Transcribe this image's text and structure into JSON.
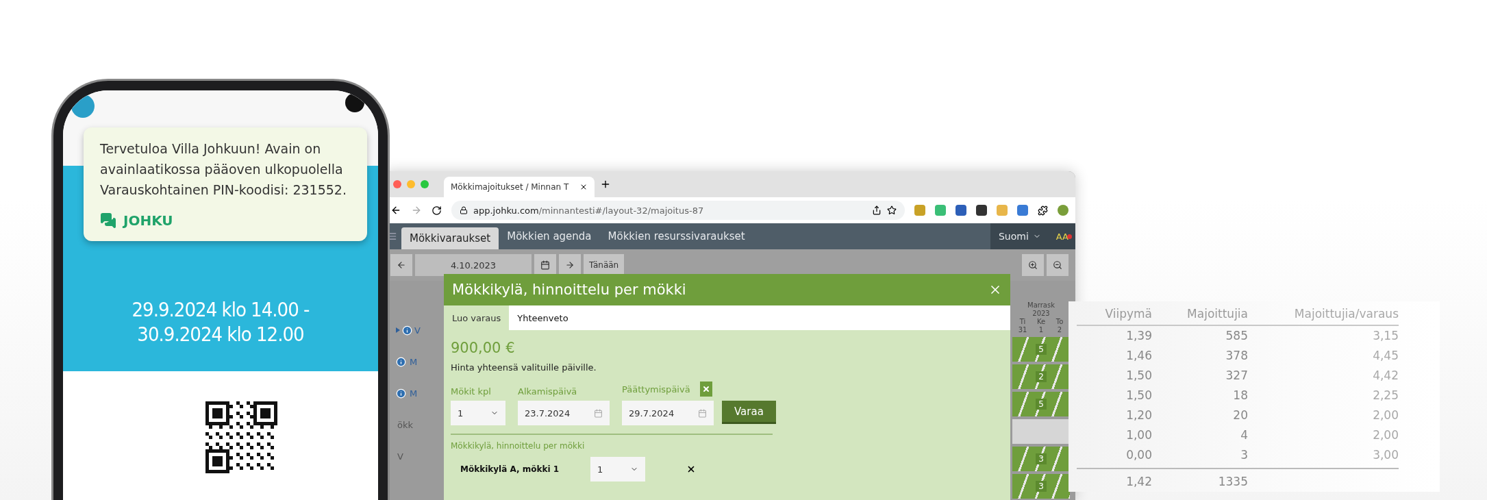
{
  "phone": {
    "notification": {
      "lines": [
        "Tervetuloa Villa Johkuun!  Avain on",
        "avainlaatikossa pääoven ulkopuolella",
        "Varauskohtainen PIN-koodisi: 231552."
      ],
      "brand": "JOHKU"
    },
    "dates": [
      "29.9.2024 klo 14.00 -",
      "30.9.2024 klo 12.00"
    ]
  },
  "browser": {
    "tab_title": "Mökkimajoitukset / Minnan T",
    "url_host": "app.johku.com",
    "url_path": "/minnantesti#/layout-32/majoitus-87"
  },
  "app": {
    "nav_tabs": [
      {
        "label": "Mökkivaraukset",
        "selected": true
      },
      {
        "label": "Mökkien agenda",
        "selected": false
      },
      {
        "label": "Mökkien resurssivaraukset",
        "selected": false
      }
    ],
    "language": "Suomi",
    "user": "AA",
    "date": "4.10.2023",
    "today": "Tänään",
    "list_rows": [
      {
        "label": "V",
        "info": true,
        "expandable": true
      },
      {
        "label": "M",
        "info": true,
        "expandable": false
      },
      {
        "label": "M",
        "info": true,
        "expandable": false
      },
      {
        "label": "ökk",
        "info": false,
        "expandable": false
      },
      {
        "label": "V",
        "info": false,
        "expandable": false
      }
    ]
  },
  "modal": {
    "title": "Mökkikylä, hinnoittelu per mökki",
    "tabs": [
      {
        "label": "Luo varaus",
        "selected": true
      },
      {
        "label": "Yhteenveto",
        "selected": false
      }
    ],
    "price": "900,00 €",
    "note": "Hinta yhteensä valituille päiville.",
    "fields": [
      {
        "kind": "select",
        "label": "Mökit kpl",
        "value": "1"
      },
      {
        "kind": "date",
        "label": "Alkamispäivä",
        "value": "23.7.2024"
      },
      {
        "kind": "date",
        "label": "Päättymispäivä",
        "value": "29.7.2024",
        "clearable": true
      }
    ],
    "book_button": "Varaa",
    "section_title": "Mökkikylä, hinnoittelu per mökki",
    "items": [
      {
        "name": "Mökkikylä A, mökki 1",
        "quantity": "1"
      }
    ]
  },
  "calendar": {
    "month": "Marrask",
    "year": "2023",
    "days": [
      {
        "name": "Ti",
        "date": "31"
      },
      {
        "name": "Ke",
        "date": "1"
      },
      {
        "name": "To",
        "date": "2"
      }
    ],
    "rows": [
      {
        "booked": true,
        "value": "5"
      },
      {
        "booked": true,
        "value": "2"
      },
      {
        "booked": true,
        "value": "5"
      },
      {
        "booked": false,
        "value": ""
      },
      {
        "booked": true,
        "value": "3"
      },
      {
        "booked": true,
        "value": "3"
      }
    ]
  },
  "stats_table": {
    "columns": [
      "Viipymä",
      "Majoittujia",
      "Majoittujia/varaus"
    ],
    "rows": [
      [
        "1,39",
        "585",
        "3,15"
      ],
      [
        "1,46",
        "378",
        "4,45"
      ],
      [
        "1,50",
        "327",
        "4,42"
      ],
      [
        "1,50",
        "18",
        "2,25"
      ],
      [
        "1,20",
        "20",
        "2,00"
      ],
      [
        "1,00",
        "4",
        "2,00"
      ],
      [
        "0,00",
        "3",
        "3,00"
      ]
    ],
    "total": [
      "1,42",
      "1335"
    ]
  }
}
